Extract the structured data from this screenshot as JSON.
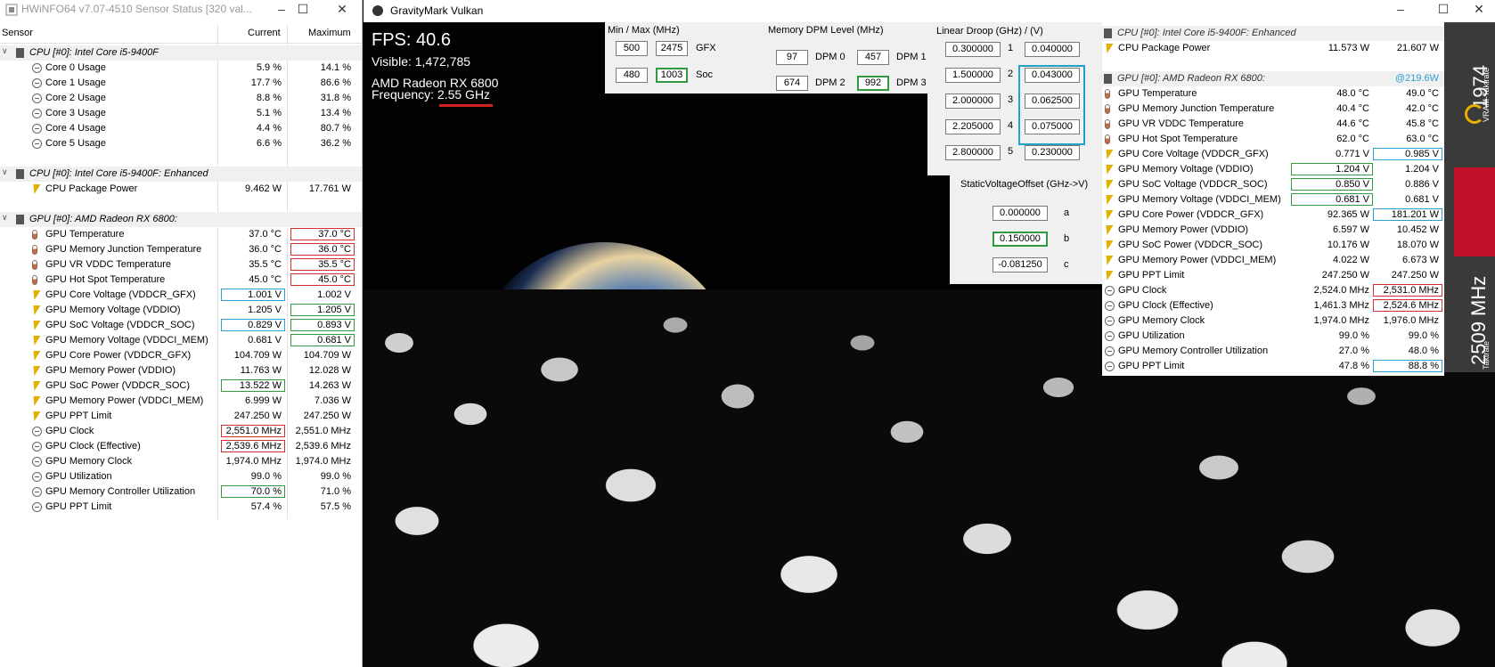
{
  "hwinfo": {
    "title": "HWiNFO64 v7.07-4510 Sensor Status [320 val...",
    "col_sensor": "Sensor",
    "col_current": "Current",
    "col_maximum": "Maximum",
    "rows": [
      {
        "t": "group",
        "label": "CPU [#0]: Intel Core i5-9400F"
      },
      {
        "t": "clock",
        "label": "Core 0 Usage",
        "cur": "5.9 %",
        "max": "14.1 %"
      },
      {
        "t": "clock",
        "label": "Core 1 Usage",
        "cur": "17.7 %",
        "max": "86.6 %"
      },
      {
        "t": "clock",
        "label": "Core 2 Usage",
        "cur": "8.8 %",
        "max": "31.8 %"
      },
      {
        "t": "clock",
        "label": "Core 3 Usage",
        "cur": "5.1 %",
        "max": "13.4 %"
      },
      {
        "t": "clock",
        "label": "Core 4 Usage",
        "cur": "4.4 %",
        "max": "80.7 %"
      },
      {
        "t": "clock",
        "label": "Core 5 Usage",
        "cur": "6.6 %",
        "max": "36.2 %"
      },
      {
        "t": "blank"
      },
      {
        "t": "group",
        "label": "CPU [#0]: Intel Core i5-9400F: Enhanced"
      },
      {
        "t": "bolt",
        "label": "CPU Package Power",
        "cur": "9.462 W",
        "max": "17.761 W"
      },
      {
        "t": "blank"
      },
      {
        "t": "group",
        "label": "GPU [#0]: AMD Radeon RX 6800:"
      },
      {
        "t": "therm",
        "label": "GPU Temperature",
        "cur": "37.0 °C",
        "max": "37.0 °C",
        "mbox": "r"
      },
      {
        "t": "therm",
        "label": "GPU Memory Junction Temperature",
        "cur": "36.0 °C",
        "max": "36.0 °C",
        "mbox": "r"
      },
      {
        "t": "therm",
        "label": "GPU VR VDDC Temperature",
        "cur": "35.5 °C",
        "max": "35.5 °C",
        "mbox": "r"
      },
      {
        "t": "therm",
        "label": "GPU Hot Spot Temperature",
        "cur": "45.0 °C",
        "max": "45.0 °C",
        "mbox": "r"
      },
      {
        "t": "bolt",
        "label": "GPU Core Voltage (VDDCR_GFX)",
        "cur": "1.001 V",
        "max": "1.002 V",
        "cbox": "b"
      },
      {
        "t": "bolt",
        "label": "GPU Memory Voltage (VDDIO)",
        "cur": "1.205 V",
        "max": "1.205 V",
        "mbox": "g"
      },
      {
        "t": "bolt",
        "label": "GPU SoC Voltage (VDDCR_SOC)",
        "cur": "0.829 V",
        "max": "0.893 V",
        "cbox": "b",
        "mbox": "g"
      },
      {
        "t": "bolt",
        "label": "GPU Memory Voltage (VDDCI_MEM)",
        "cur": "0.681 V",
        "max": "0.681 V",
        "mbox": "g"
      },
      {
        "t": "bolt",
        "label": "GPU Core Power (VDDCR_GFX)",
        "cur": "104.709 W",
        "max": "104.709 W"
      },
      {
        "t": "bolt",
        "label": "GPU Memory Power (VDDIO)",
        "cur": "11.763 W",
        "max": "12.028 W"
      },
      {
        "t": "bolt",
        "label": "GPU SoC Power (VDDCR_SOC)",
        "cur": "13.522 W",
        "max": "14.263 W",
        "cbox": "g"
      },
      {
        "t": "bolt",
        "label": "GPU Memory Power (VDDCI_MEM)",
        "cur": "6.999 W",
        "max": "7.036 W"
      },
      {
        "t": "bolt",
        "label": "GPU PPT Limit",
        "cur": "247.250 W",
        "max": "247.250 W"
      },
      {
        "t": "clock",
        "label": "GPU Clock",
        "cur": "2,551.0 MHz",
        "max": "2,551.0 MHz",
        "cbox": "r"
      },
      {
        "t": "clock",
        "label": "GPU Clock (Effective)",
        "cur": "2,539.6 MHz",
        "max": "2,539.6 MHz",
        "cbox": "r"
      },
      {
        "t": "clock",
        "label": "GPU Memory Clock",
        "cur": "1,974.0 MHz",
        "max": "1,974.0 MHz"
      },
      {
        "t": "clock",
        "label": "GPU Utilization",
        "cur": "99.0 %",
        "max": "99.0 %"
      },
      {
        "t": "clock",
        "label": "GPU Memory Controller Utilization",
        "cur": "70.0 %",
        "max": "71.0 %",
        "cbox": "g"
      },
      {
        "t": "clock",
        "label": "GPU PPT Limit",
        "cur": "57.4 %",
        "max": "57.5 %"
      }
    ]
  },
  "gravitymark": {
    "title": "GravityMark Vulkan",
    "fps": "FPS: 40.6",
    "visible": "Visible: 1,472,785",
    "gpu_name": "AMD Radeon RX 6800",
    "frequency": "Frequency: 2.55 GHz"
  },
  "minmax": {
    "title": "Min / Max (MHz)",
    "gfx_min": "500",
    "gfx_max": "2475",
    "gfx_label": "GFX",
    "soc_min": "480",
    "soc_max": "1003",
    "soc_label": "Soc"
  },
  "dpm": {
    "title": "Memory DPM Level (MHz)",
    "dpm0_val": "97",
    "dpm0_label": "DPM 0",
    "dpm1_val": "457",
    "dpm1_label": "DPM 1",
    "dpm2_val": "674",
    "dpm2_label": "DPM 2",
    "dpm3_val": "992",
    "dpm3_label": "DPM 3"
  },
  "droop": {
    "title": "Linear Droop (GHz) / (V)",
    "rows": [
      {
        "ghz": "0.300000",
        "idx": "1",
        "v": "0.040000"
      },
      {
        "ghz": "1.500000",
        "idx": "2",
        "v": "0.043000"
      },
      {
        "ghz": "2.000000",
        "idx": "3",
        "v": "0.062500"
      },
      {
        "ghz": "2.205000",
        "idx": "4",
        "v": "0.075000"
      },
      {
        "ghz": "2.800000",
        "idx": "5",
        "v": "0.230000"
      }
    ]
  },
  "svo": {
    "title": "StaticVoltageOffset (GHz->V)",
    "a_val": "0.000000",
    "a_label": "a",
    "b_val": "0.150000",
    "b_label": "b",
    "c_val": "-0.081250",
    "c_label": "c"
  },
  "overlay": {
    "rows": [
      {
        "t": "group",
        "label": "CPU [#0]: Intel Core i5-9400F: Enhanced"
      },
      {
        "t": "bolt",
        "label": "CPU Package Power",
        "cur": "11.573 W",
        "max": "21.607 W"
      },
      {
        "t": "blank"
      },
      {
        "t": "group",
        "label": "GPU [#0]: AMD Radeon RX 6800:",
        "extra": "@219.6W"
      },
      {
        "t": "therm",
        "label": "GPU Temperature",
        "cur": "48.0 °C",
        "max": "49.0 °C"
      },
      {
        "t": "therm",
        "label": "GPU Memory Junction Temperature",
        "cur": "40.4 °C",
        "max": "42.0 °C"
      },
      {
        "t": "therm",
        "label": "GPU VR VDDC Temperature",
        "cur": "44.6 °C",
        "max": "45.8 °C"
      },
      {
        "t": "therm",
        "label": "GPU Hot Spot Temperature",
        "cur": "62.0 °C",
        "max": "63.0 °C"
      },
      {
        "t": "bolt",
        "label": "GPU Core Voltage (VDDCR_GFX)",
        "cur": "0.771 V",
        "max": "0.985 V",
        "mbox": "b"
      },
      {
        "t": "bolt",
        "label": "GPU Memory Voltage (VDDIO)",
        "cur": "1.204 V",
        "max": "1.204 V",
        "cbox": "g"
      },
      {
        "t": "bolt",
        "label": "GPU SoC Voltage (VDDCR_SOC)",
        "cur": "0.850 V",
        "max": "0.886 V",
        "cbox": "g"
      },
      {
        "t": "bolt",
        "label": "GPU Memory Voltage (VDDCI_MEM)",
        "cur": "0.681 V",
        "max": "0.681 V",
        "cbox": "g"
      },
      {
        "t": "bolt",
        "label": "GPU Core Power (VDDCR_GFX)",
        "cur": "92.365 W",
        "max": "181.201 W",
        "mbox": "b"
      },
      {
        "t": "bolt",
        "label": "GPU Memory Power (VDDIO)",
        "cur": "6.597 W",
        "max": "10.452 W"
      },
      {
        "t": "bolt",
        "label": "GPU SoC Power (VDDCR_SOC)",
        "cur": "10.176 W",
        "max": "18.070 W"
      },
      {
        "t": "bolt",
        "label": "GPU Memory Power (VDDCI_MEM)",
        "cur": "4.022 W",
        "max": "6.673 W"
      },
      {
        "t": "bolt",
        "label": "GPU PPT Limit",
        "cur": "247.250 W",
        "max": "247.250 W"
      },
      {
        "t": "clock",
        "label": "GPU Clock",
        "cur": "2,524.0 MHz",
        "max": "2,531.0 MHz",
        "mbox": "r"
      },
      {
        "t": "clock",
        "label": "GPU Clock (Effective)",
        "cur": "1,461.3 MHz",
        "max": "2,524.6 MHz",
        "mbox": "r"
      },
      {
        "t": "clock",
        "label": "GPU Memory Clock",
        "cur": "1,974.0 MHz",
        "max": "1,976.0 MHz"
      },
      {
        "t": "clock",
        "label": "GPU Utilization",
        "cur": "99.0 %",
        "max": "99.0 %"
      },
      {
        "t": "clock",
        "label": "GPU Memory Controller Utilization",
        "cur": "27.0 %",
        "max": "48.0 %"
      },
      {
        "t": "clock",
        "label": "GPU PPT Limit",
        "cur": "47.8 %",
        "max": "88.8 %",
        "mbox": "b"
      }
    ]
  },
  "tray": {
    "vram_label": "VRAM-Taktrate",
    "vram_value": "1974",
    "core_label": "Taktrate",
    "core_value": "2509 MHz"
  },
  "colors": {
    "highlight_red": "#d43030",
    "highlight_green": "#2f9a40",
    "highlight_blue": "#2a9fd6",
    "accent_cyan": "#1fa2c9"
  }
}
